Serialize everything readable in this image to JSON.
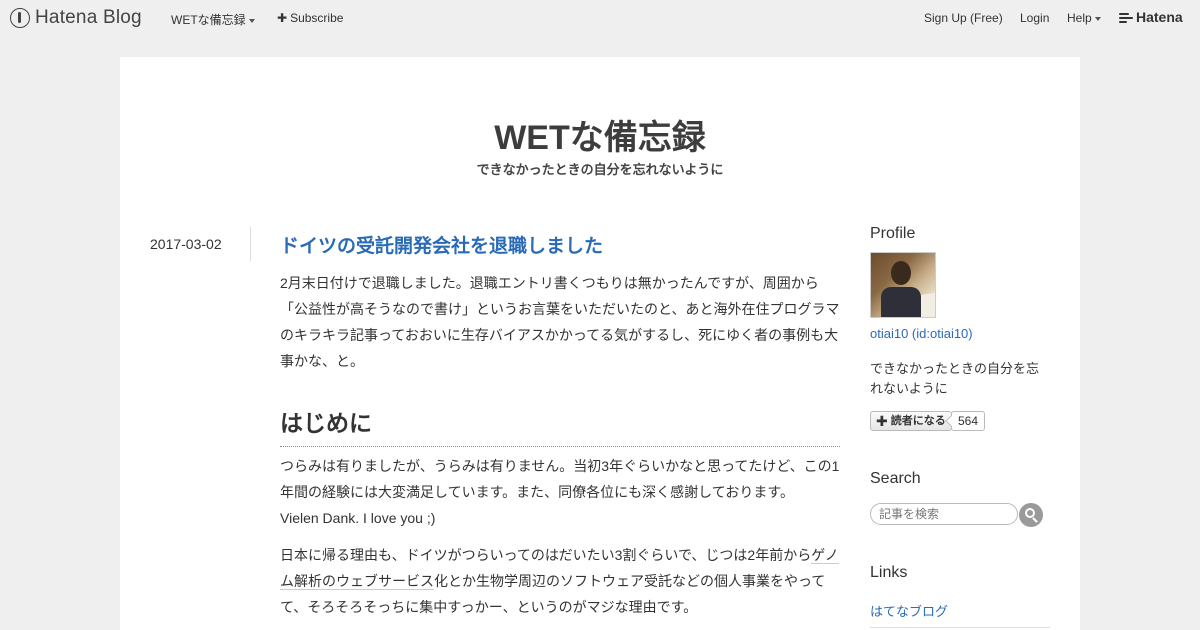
{
  "topbar": {
    "brand": "Hatena Blog",
    "blog_menu": "WETな備忘録",
    "subscribe": "Subscribe",
    "signup": "Sign Up (Free)",
    "login": "Login",
    "help": "Help",
    "hatena": "Hatena"
  },
  "blog": {
    "title": "WETな備忘録",
    "description": "できなかったときの自分を忘れないように"
  },
  "entry": {
    "date": "2017-03-02",
    "title": "ドイツの受託開発会社を退職しました",
    "p1": "2月末日付けで退職しました。退職エントリ書くつもりは無かったんですが、周囲から「公益性が高そうなので書け」というお言葉をいただいたのと、あと海外在住プログラマのキラキラ記事っておおいに生存バイアスかかってる気がするし、死にゆく者の事例も大事かな、と。",
    "h2": "はじめに",
    "p2": "つらみは有りましたが、うらみは有りません。当初3年ぐらいかなと思ってたけど、この1年間の経験には大変満足しています。また、同僚各位にも深く感謝しております。",
    "p2b": "Vielen Dank. I love you ;)",
    "p3_pre": "日本に帰る理由も、ドイツがつらいってのはだいたい3割ぐらいで、じつは2年前から",
    "p3_link": "ゲノム解析のウェブサービス",
    "p3_post": "化とか生物学周辺のソフトウェア受託などの個人事業をやってて、そろそろそっちに集中すっかー、というのがマジな理由です。"
  },
  "sidebar": {
    "profile_heading": "Profile",
    "user": "otiai10 (id:otiai10)",
    "user_desc": "できなかったときの自分を忘れないように",
    "subscribe_label": "読者になる",
    "subscriber_count": "564",
    "search_heading": "Search",
    "search_placeholder": "記事を検索",
    "links_heading": "Links",
    "link1": "はてなブログ"
  }
}
